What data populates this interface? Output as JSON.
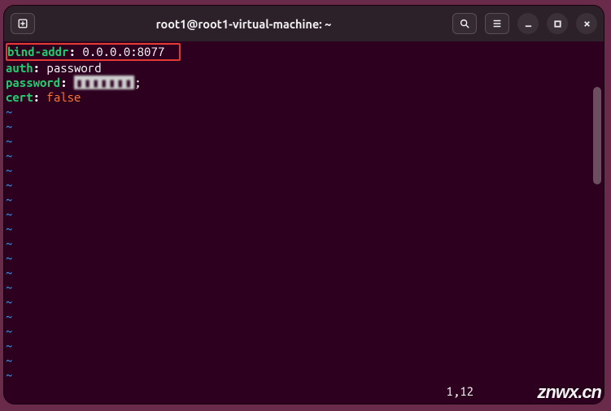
{
  "window": {
    "title": "root1@root1-virtual-machine: ~"
  },
  "config": {
    "lines": [
      {
        "key": "bind-addr",
        "value": "0.0.0.0:8077",
        "highlight": true
      },
      {
        "key": "auth",
        "value": "password"
      },
      {
        "key": "password",
        "value_masked": "▮▮▮▮▮▮▮",
        "tail": ";"
      },
      {
        "key": "cert",
        "value": "false",
        "value_style": "orange"
      }
    ]
  },
  "editor": {
    "empty_line_marker": "~",
    "empty_line_count": 19,
    "cursor_position": "1,12"
  },
  "watermark": "znwx.cn"
}
